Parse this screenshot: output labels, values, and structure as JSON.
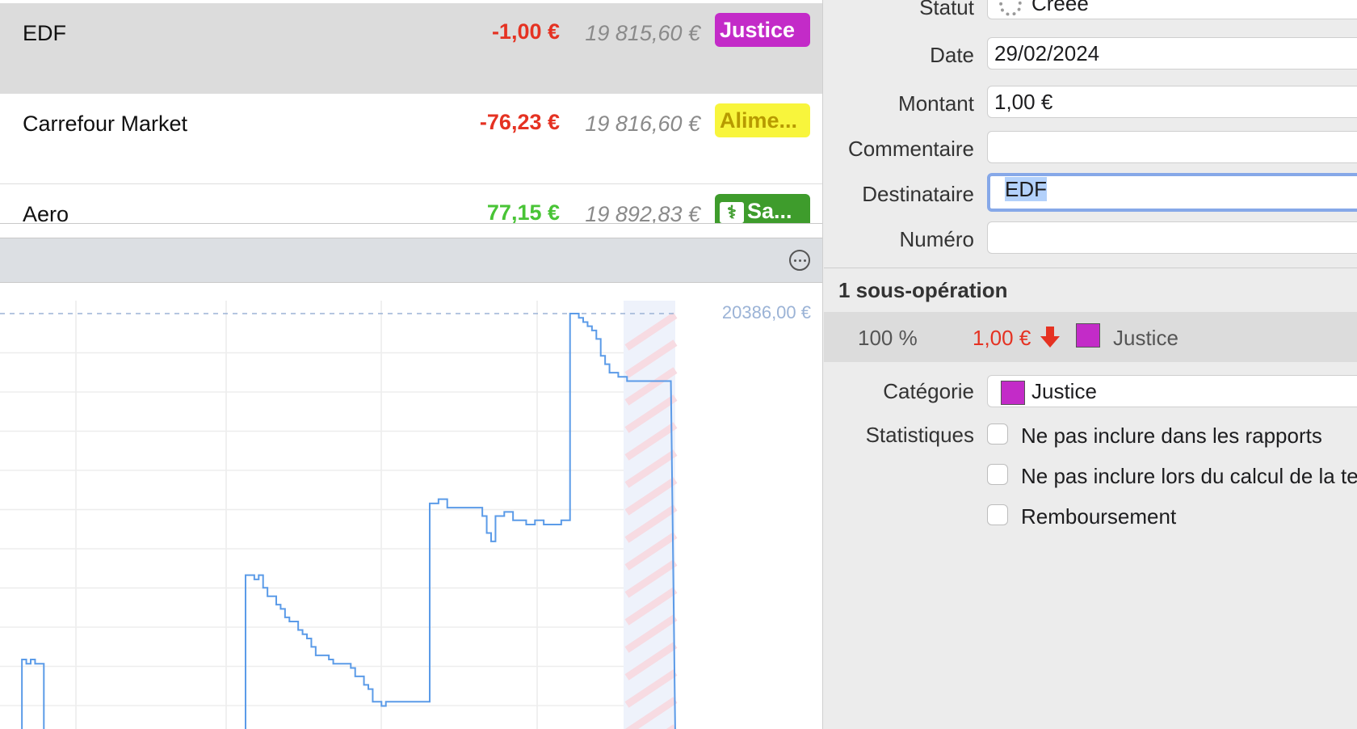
{
  "transactions": [
    {
      "payee": "EDF",
      "amount": "-1,00 €",
      "balance": "19 815,60 €",
      "tag": "Justice",
      "tag_bg": "#c32bc8",
      "tag_fg": "#ffffff",
      "amount_color": "#e53222",
      "selected": true
    },
    {
      "payee": "Carrefour Market",
      "amount": "-76,23 €",
      "balance": "19 816,60 €",
      "tag": "Alime...",
      "tag_bg": "#f8f53c",
      "tag_fg": "#b79a00",
      "amount_color": "#e53222",
      "selected": false
    },
    {
      "payee": "Aero",
      "amount": "77,15 €",
      "balance": "19 892,83 €",
      "tag": "Sa...",
      "tag_bg": "#3e9c2c",
      "tag_fg": "#ffffff",
      "amount_color": "#49c436",
      "selected": false
    }
  ],
  "chart_data": {
    "type": "line",
    "max_label": "20386,00 €",
    "x_gridlines": 5,
    "y_gridlines": 11,
    "series": [
      {
        "values": [
          0,
          0,
          0,
          0,
          0,
          18,
          17,
          18,
          17,
          17,
          0,
          0,
          0,
          0,
          0,
          0,
          0,
          0,
          0,
          0,
          0,
          0,
          0,
          0,
          0,
          0,
          0,
          0,
          0,
          0,
          0,
          0,
          0,
          0,
          0,
          0,
          0,
          0,
          0,
          0,
          0,
          0,
          0,
          0,
          0,
          0,
          0,
          0,
          0,
          0,
          0,
          0,
          0,
          0,
          0,
          0,
          38,
          38,
          37,
          38,
          35,
          33,
          33,
          31,
          30,
          28,
          27,
          27,
          25,
          24,
          23,
          21,
          19,
          19,
          19,
          18,
          17,
          17,
          17,
          17,
          16,
          14,
          14,
          12,
          11,
          8,
          8,
          7,
          8,
          8,
          8,
          8,
          8,
          8,
          8,
          8,
          8,
          8,
          55,
          55,
          56,
          56,
          54,
          54,
          54,
          54,
          54,
          54,
          54,
          54,
          52,
          48,
          46,
          52,
          52,
          53,
          53,
          51,
          51,
          51,
          50,
          50,
          51,
          51,
          50,
          50,
          50,
          50,
          51,
          51,
          100,
          100,
          99,
          98,
          97,
          96,
          94,
          90,
          88,
          86,
          86,
          85,
          85,
          84,
          84,
          84,
          84,
          84,
          84,
          84,
          84,
          84,
          84,
          84,
          0
        ]
      }
    ]
  },
  "detail": {
    "labels": {
      "statut": "Statut",
      "date": "Date",
      "montant": "Montant",
      "commentaire": "Commentaire",
      "destinataire": "Destinataire",
      "numero": "Numéro",
      "categorie": "Catégorie",
      "statistiques": "Statistiques"
    },
    "statut": "Créée",
    "date": "29/02/2024",
    "montant": "1,00 €",
    "commentaire": "",
    "destinataire": "EDF",
    "numero": "",
    "sub_ops_title": "1 sous-opération",
    "sub_op": {
      "percent": "100 %",
      "amount": "1,00 €",
      "category": "Justice"
    },
    "categorie": "Justice",
    "checks": [
      {
        "label": "Ne pas inclure dans les rapports",
        "checked": false
      },
      {
        "label": "Ne pas inclure lors du calcul de la te",
        "checked": false
      },
      {
        "label": "Remboursement",
        "checked": false
      }
    ]
  },
  "colors": {
    "negative": "#e53222",
    "positive": "#49c436",
    "line": "#5b9be8",
    "justice": "#c32bc8"
  }
}
